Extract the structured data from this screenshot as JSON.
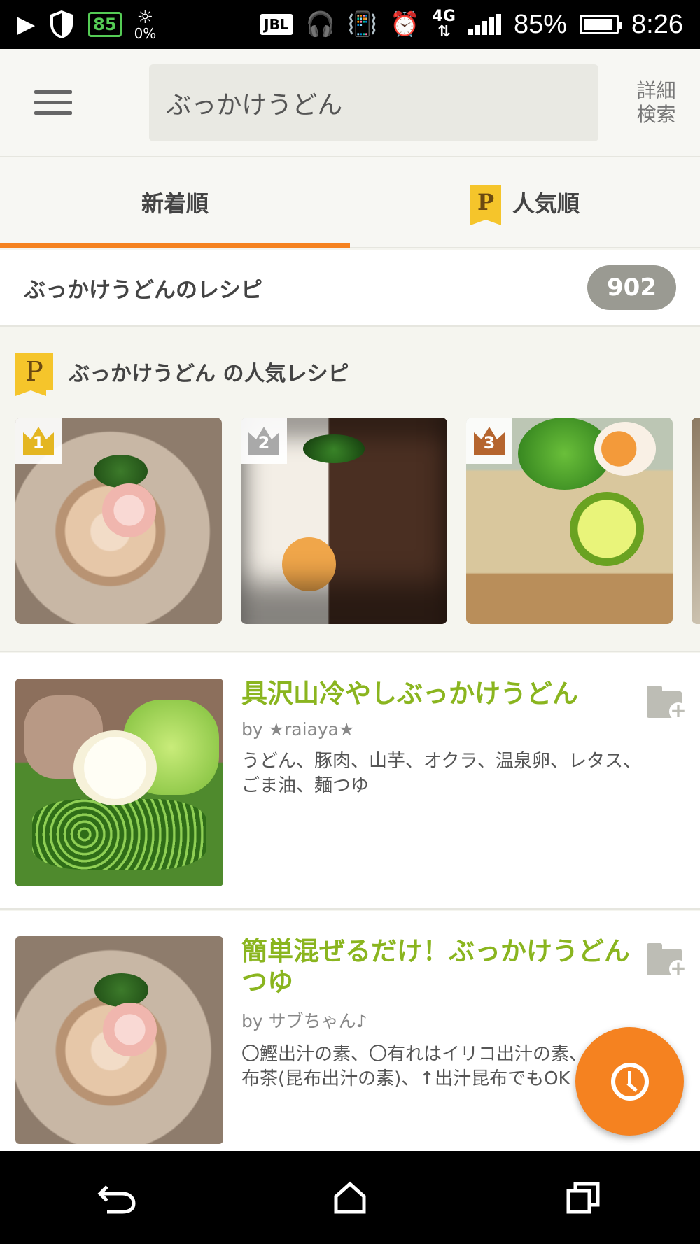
{
  "status_bar": {
    "badge": "85",
    "data_percent": "0%",
    "jbl": "JBL",
    "network": "4G",
    "battery": "85%",
    "time": "8:26"
  },
  "header": {
    "search_value": "ぶっかけうどん",
    "detail_search_line1": "詳細",
    "detail_search_line2": "検索"
  },
  "tabs": [
    {
      "label": "新着順",
      "active": true
    },
    {
      "label": "人気順",
      "active": false,
      "icon": "premium-p-icon"
    }
  ],
  "count_row": {
    "label": "ぶっかけうどんのレシピ",
    "count": "902"
  },
  "popular": {
    "icon_letter": "P",
    "title": "ぶっかけうどん の人気レシピ",
    "ranks": [
      {
        "rank": "1",
        "color": "#e4b621"
      },
      {
        "rank": "2",
        "color": "#a9a9a9"
      },
      {
        "rank": "3",
        "color": "#b5652e"
      }
    ]
  },
  "recipes": [
    {
      "title": "具沢山冷やしぶっかけうどん",
      "author": "by ★raiaya★",
      "ingredients": "うどん、豚肉、山芋、オクラ、温泉卵、レタス、ごま油、麺つゆ"
    },
    {
      "title": "簡単混ぜるだけ！ぶっかけうどん つゆ",
      "author": "by サブちゃん♪",
      "ingredients": "〇鰹出汁の素、〇有れはイリコ出汁の素、〇昆布茶(昆布出汁の素)、↑出汁昆布でもOK"
    }
  ],
  "colors": {
    "accent": "#f58220",
    "title_green": "#8ab51f",
    "badge_gray": "#9a9a92"
  }
}
